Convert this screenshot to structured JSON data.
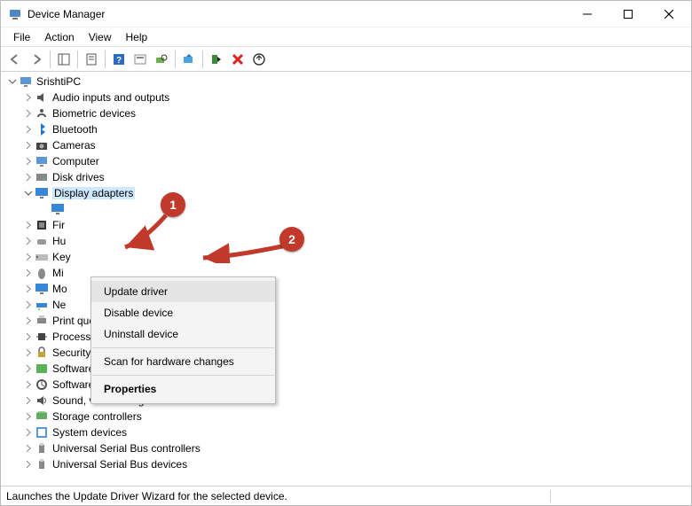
{
  "window": {
    "title": "Device Manager"
  },
  "menus": {
    "file": "File",
    "action": "Action",
    "view": "View",
    "help": "Help"
  },
  "tree": {
    "root": "SrishtiPC",
    "items": [
      "Audio inputs and outputs",
      "Biometric devices",
      "Bluetooth",
      "Cameras",
      "Computer",
      "Disk drives",
      "Display adapters",
      "Fir",
      "Hu",
      "Key",
      "Mi",
      "Mo",
      "Ne",
      "Print queues",
      "Processors",
      "Security devices",
      "Software components",
      "Software devices",
      "Sound, video and game controllers",
      "Storage controllers",
      "System devices",
      "Universal Serial Bus controllers",
      "Universal Serial Bus devices"
    ]
  },
  "context_menu": {
    "update": "Update driver",
    "disable": "Disable device",
    "uninstall": "Uninstall device",
    "scan": "Scan for hardware changes",
    "properties": "Properties"
  },
  "status": "Launches the Update Driver Wizard for the selected device.",
  "callouts": {
    "one": "1",
    "two": "2"
  }
}
